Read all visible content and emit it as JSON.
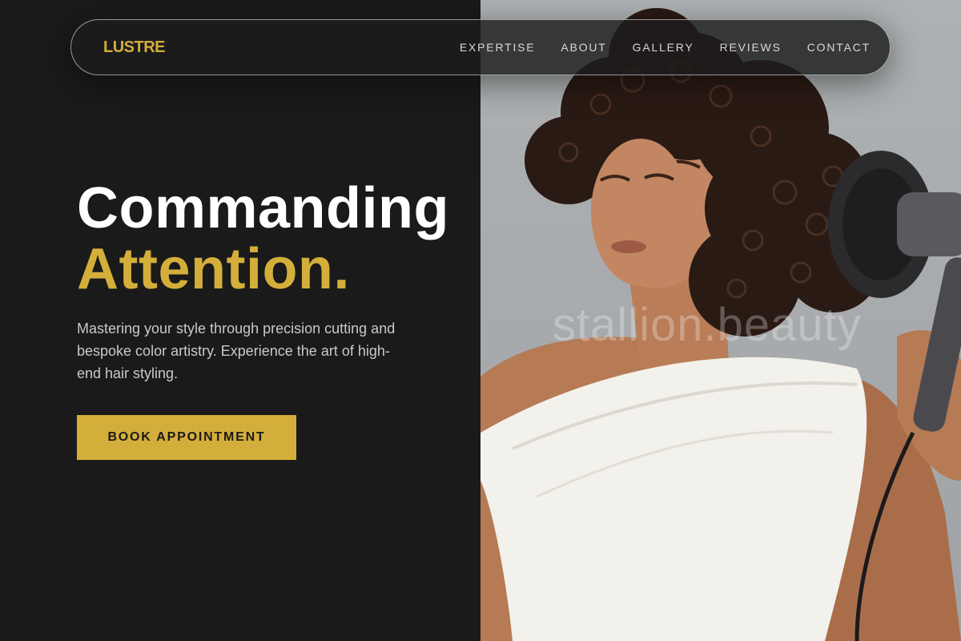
{
  "brand": {
    "logo": "LUSTRE"
  },
  "nav": {
    "items": [
      {
        "label": "EXPERTISE"
      },
      {
        "label": "ABOUT"
      },
      {
        "label": "GALLERY"
      },
      {
        "label": "REVIEWS"
      },
      {
        "label": "CONTACT"
      }
    ]
  },
  "hero": {
    "headline_line1": "Commanding",
    "headline_line2": "Attention.",
    "subtitle": "Mastering your style through precision cutting and bespoke color artistry. Experience the art of high-end hair styling.",
    "cta_label": "BOOK APPOINTMENT"
  },
  "photo": {
    "watermark": "stallion.beauty"
  },
  "colors": {
    "background": "#1a1a1a",
    "accent": "#d4ae3a",
    "text_primary": "#ffffff",
    "text_secondary": "#c9c9c9"
  }
}
